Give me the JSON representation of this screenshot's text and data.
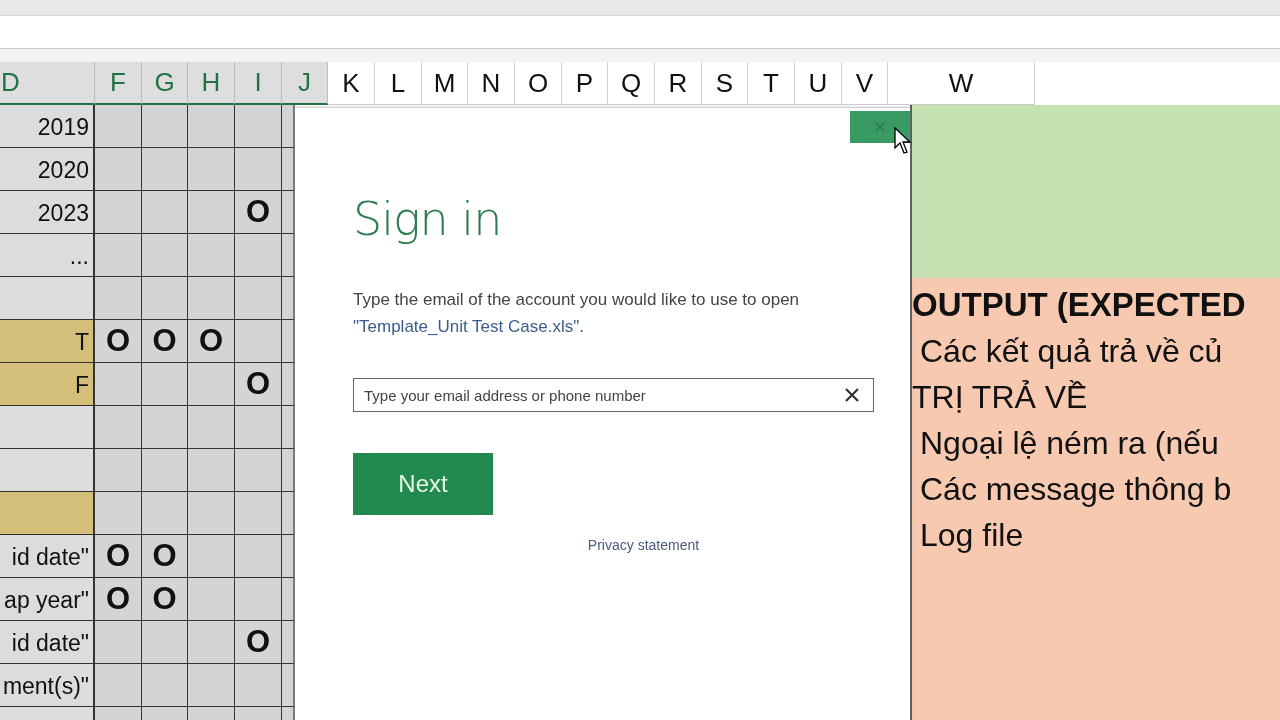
{
  "column_headers": [
    {
      "label": "D",
      "selected": true
    },
    {
      "label": "F",
      "selected": true
    },
    {
      "label": "G",
      "selected": true
    },
    {
      "label": "H",
      "selected": true
    },
    {
      "label": "I",
      "selected": true
    },
    {
      "label": "J",
      "selected": true
    },
    {
      "label": "K",
      "selected": false
    },
    {
      "label": "L",
      "selected": false
    },
    {
      "label": "M",
      "selected": false
    },
    {
      "label": "N",
      "selected": false
    },
    {
      "label": "O",
      "selected": false
    },
    {
      "label": "P",
      "selected": false
    },
    {
      "label": "Q",
      "selected": false
    },
    {
      "label": "R",
      "selected": false
    },
    {
      "label": "S",
      "selected": false
    },
    {
      "label": "T",
      "selected": false
    },
    {
      "label": "U",
      "selected": false
    },
    {
      "label": "V",
      "selected": false
    },
    {
      "label": "W",
      "selected": false
    }
  ],
  "rows": [
    {
      "label": "2019",
      "highlighted": false,
      "cells": [
        {},
        {},
        {},
        {}
      ]
    },
    {
      "label": "2020",
      "highlighted": false,
      "cells": [
        {},
        {},
        {},
        {}
      ]
    },
    {
      "label": "2023",
      "highlighted": false,
      "cells": [
        {},
        {},
        {},
        {
          "text": "O"
        }
      ]
    },
    {
      "label": "...",
      "highlighted": false,
      "cells": [
        {},
        {},
        {},
        {}
      ]
    },
    {
      "highlighted": false,
      "cells": [
        {},
        {},
        {},
        {}
      ]
    },
    {
      "label": "T",
      "highlighted": true,
      "cells": [
        {
          "text": "O"
        },
        {
          "text": "O"
        },
        {
          "text": "O"
        },
        {}
      ]
    },
    {
      "label": "F",
      "highlighted": true,
      "cells": [
        {},
        {},
        {},
        {
          "text": "O"
        }
      ]
    },
    {
      "highlighted": false,
      "cells": [
        {},
        {},
        {},
        {}
      ]
    },
    {
      "highlighted": false,
      "cells": [
        {},
        {},
        {},
        {}
      ]
    },
    {
      "highlighted": true,
      "cells": [
        {},
        {},
        {},
        {}
      ]
    },
    {
      "label": "id date\"",
      "highlighted": false,
      "cells": [
        {
          "text": "O"
        },
        {
          "text": "O"
        },
        {},
        {}
      ]
    },
    {
      "label": "ap year\"",
      "highlighted": false,
      "cells": [
        {
          "text": "O"
        },
        {
          "text": "O"
        },
        {},
        {}
      ]
    },
    {
      "label": "id date\"",
      "highlighted": false,
      "cells": [
        {},
        {},
        {},
        {
          "text": "O"
        }
      ]
    },
    {
      "label": "ment(s)\"",
      "highlighted": false,
      "cells": [
        {},
        {},
        {},
        {}
      ]
    },
    {
      "highlighted": false,
      "cells": [
        {},
        {},
        {},
        {}
      ]
    }
  ],
  "dialog": {
    "title": "Sign in",
    "description": "Type the email of the account you would like to use to open ",
    "file_name": "\"Template_Unit Test Case.xls\"",
    "description_end": ".",
    "email_field": {
      "placeholder": "Type your email address or phone number"
    },
    "next_button": "Next",
    "privacy_link": "Privacy statement"
  },
  "output_panel": {
    "heading": "OUTPUT (EXPECTED",
    "lines": [
      {
        "text": "Các kết quả trả về củ",
        "indented": true
      },
      {
        "text": "TRỊ TRẢ VỀ",
        "indented": false
      },
      {
        "text": "Ngoại lệ ném ra (nếu",
        "indented": true
      },
      {
        "text": "Các message thông b",
        "indented": true
      },
      {
        "text": "Log file",
        "indented": true
      }
    ]
  }
}
